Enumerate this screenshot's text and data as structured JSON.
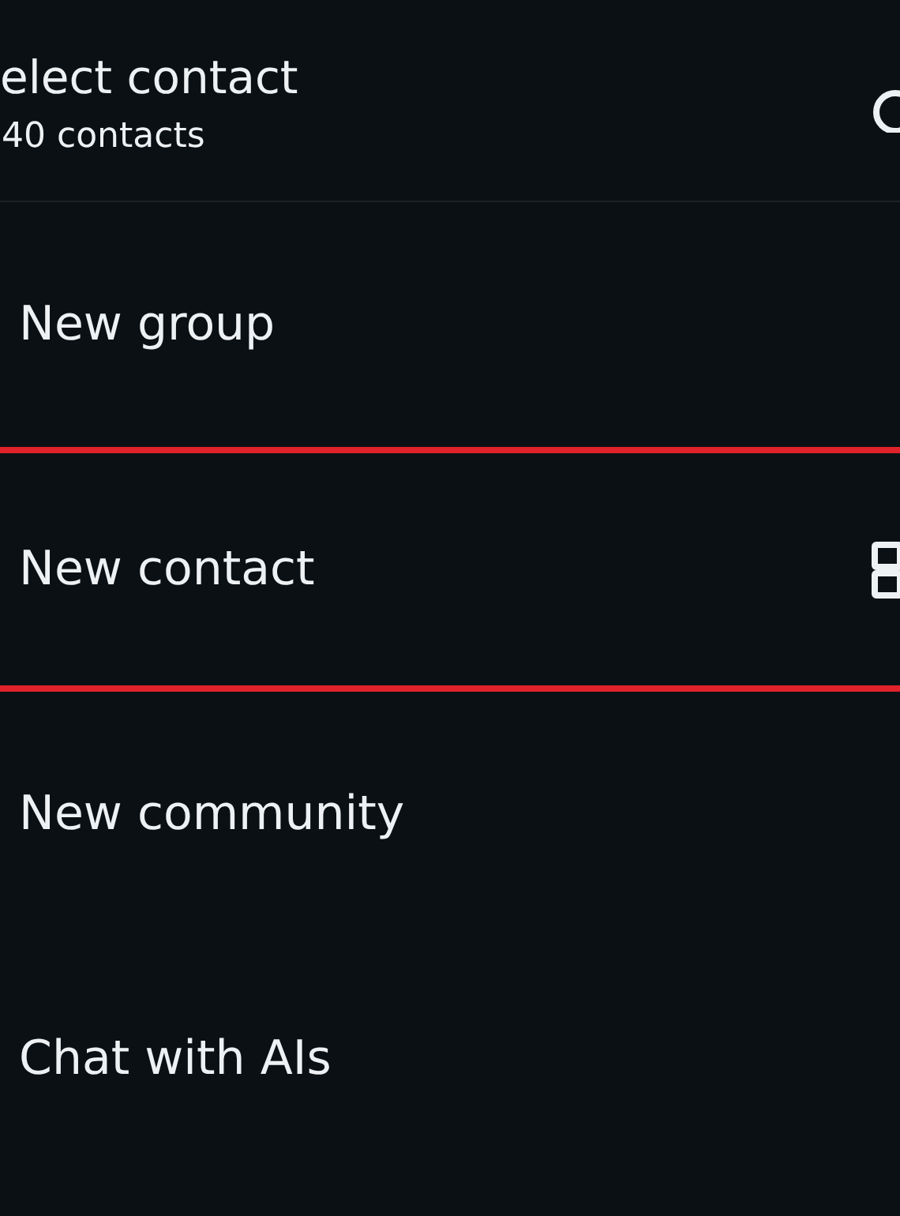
{
  "header": {
    "title": "elect contact",
    "subtitle": "40 contacts"
  },
  "options": [
    {
      "label": "New group",
      "highlighted": false,
      "kind": "plain"
    },
    {
      "label": "New contact",
      "highlighted": true,
      "kind": "qr"
    },
    {
      "label": "New community",
      "highlighted": false,
      "kind": "plain"
    },
    {
      "label": "Chat with AIs",
      "highlighted": false,
      "kind": "plain"
    }
  ]
}
